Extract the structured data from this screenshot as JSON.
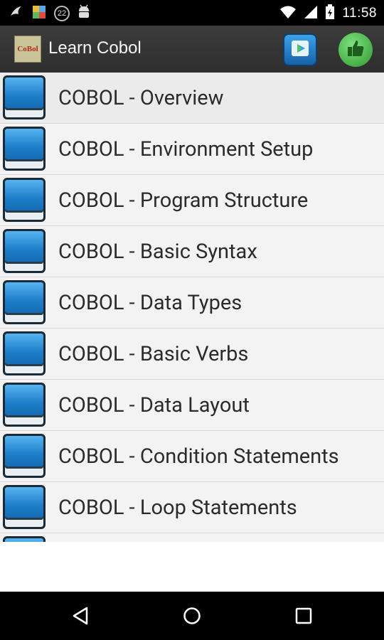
{
  "status_bar": {
    "time": "11:58",
    "notification_count": "22",
    "icons": [
      "messenger-icon",
      "photo-app-icon",
      "badge-icon",
      "android-debug-icon",
      "wifi-icon",
      "signal-icon",
      "battery-icon"
    ]
  },
  "action_bar": {
    "logo_text": "CoBol",
    "title": "Learn Cobol",
    "store_button_icon": "play-store-icon",
    "like_button_icon": "thumbs-up-icon"
  },
  "topics": [
    {
      "label": "COBOL - Overview"
    },
    {
      "label": "COBOL - Environment Setup"
    },
    {
      "label": "COBOL - Program Structure"
    },
    {
      "label": "COBOL - Basic Syntax"
    },
    {
      "label": "COBOL - Data Types"
    },
    {
      "label": "COBOL - Basic Verbs"
    },
    {
      "label": "COBOL - Data Layout"
    },
    {
      "label": "COBOL - Condition Statements"
    },
    {
      "label": "COBOL - Loop Statements"
    },
    {
      "label": ""
    }
  ],
  "nav_bar": {
    "back_icon": "back-icon",
    "home_icon": "home-icon",
    "recents_icon": "recents-icon"
  },
  "colors": {
    "status_bar": "#000000",
    "action_bar": "#333333",
    "list_bg": "#f3f3f3",
    "book_blue": "#1f7fcb",
    "like_green": "#2f9a2f"
  }
}
